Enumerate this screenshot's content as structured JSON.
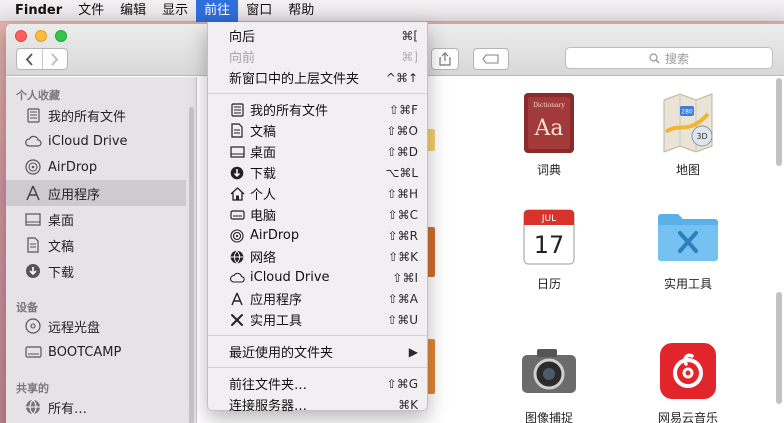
{
  "menubar": {
    "app": "Finder",
    "items": [
      "文件",
      "编辑",
      "显示",
      "前往",
      "窗口",
      "帮助"
    ]
  },
  "window": {
    "search_placeholder": "搜索"
  },
  "sidebar": {
    "sections": {
      "favorites": "个人收藏",
      "devices": "设备",
      "shared": "共享的"
    },
    "favorites": [
      {
        "label": "我的所有文件",
        "icon": "all-files-icon"
      },
      {
        "label": "iCloud Drive",
        "icon": "icloud-icon"
      },
      {
        "label": "AirDrop",
        "icon": "airdrop-icon"
      },
      {
        "label": "应用程序",
        "icon": "applications-icon",
        "selected": true
      },
      {
        "label": "桌面",
        "icon": "desktop-icon"
      },
      {
        "label": "文稿",
        "icon": "documents-icon"
      },
      {
        "label": "下载",
        "icon": "downloads-icon"
      }
    ],
    "devices": [
      {
        "label": "远程光盘",
        "icon": "remote-disc-icon"
      },
      {
        "label": "BOOTCAMP",
        "icon": "drive-icon"
      }
    ],
    "shared": [
      {
        "label": "所有…",
        "icon": "network-icon"
      }
    ]
  },
  "content": {
    "apps": [
      {
        "label": "词典",
        "icon": "dictionary-app-icon"
      },
      {
        "label": "地图",
        "icon": "maps-app-icon"
      },
      {
        "label": "日历",
        "icon": "calendar-app-icon"
      },
      {
        "label": "实用工具",
        "icon": "utilities-folder-icon"
      },
      {
        "label": "图像捕捉",
        "icon": "image-capture-app-icon"
      },
      {
        "label": "网易云音乐",
        "icon": "netease-music-app-icon"
      }
    ],
    "calendar_month": "JUL",
    "calendar_day": "17",
    "dictionary_title": "Dictionary",
    "dictionary_letters": "Aa",
    "maps_badge": "280"
  },
  "go_menu": {
    "groups": [
      [
        {
          "label": "向后",
          "shortcut": "⌘[",
          "enabled": true
        },
        {
          "label": "向前",
          "shortcut": "⌘]",
          "enabled": false
        },
        {
          "label": "新窗口中的上层文件夹",
          "shortcut": "^⌘↑",
          "enabled": true
        }
      ],
      [
        {
          "label": "我的所有文件",
          "shortcut": "⇧⌘F",
          "icon": "all-files-icon"
        },
        {
          "label": "文稿",
          "shortcut": "⇧⌘O",
          "icon": "documents-icon"
        },
        {
          "label": "桌面",
          "shortcut": "⇧⌘D",
          "icon": "desktop-icon"
        },
        {
          "label": "下载",
          "shortcut": "⌥⌘L",
          "icon": "downloads-icon"
        },
        {
          "label": "个人",
          "shortcut": "⇧⌘H",
          "icon": "home-icon"
        },
        {
          "label": "电脑",
          "shortcut": "⇧⌘C",
          "icon": "computer-icon"
        },
        {
          "label": "AirDrop",
          "shortcut": "⇧⌘R",
          "icon": "airdrop-icon"
        },
        {
          "label": "网络",
          "shortcut": "⇧⌘K",
          "icon": "network-icon"
        },
        {
          "label": "iCloud Drive",
          "shortcut": "⇧⌘I",
          "icon": "icloud-icon"
        },
        {
          "label": "应用程序",
          "shortcut": "⇧⌘A",
          "icon": "applications-icon"
        },
        {
          "label": "实用工具",
          "shortcut": "⇧⌘U",
          "icon": "utilities-icon"
        }
      ],
      [
        {
          "label": "最近使用的文件夹",
          "shortcut": "▶",
          "submenu": true
        }
      ],
      [
        {
          "label": "前往文件夹…",
          "shortcut": "⇧⌘G"
        },
        {
          "label": "连接服务器…",
          "shortcut": "⌘K"
        }
      ]
    ]
  }
}
